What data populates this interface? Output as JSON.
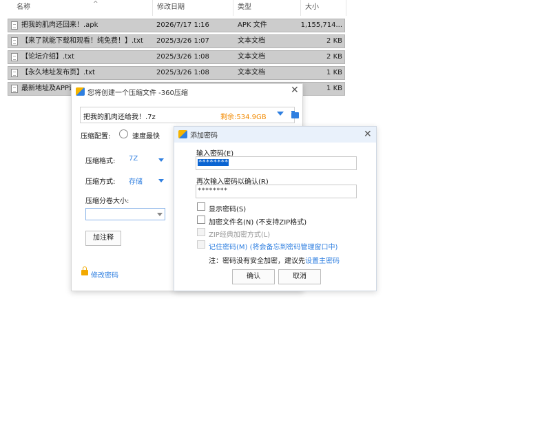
{
  "file_list": {
    "columns": {
      "name": "名称",
      "date": "修改日期",
      "type": "类型",
      "size": "大小"
    },
    "rows": [
      {
        "name": "把我的肌肉还回来！.apk",
        "date": "2026/7/17 1:16",
        "type": "APK 文件",
        "size": "1,155,714..."
      },
      {
        "name": "【来了就能下载和观看！纯免费！】.txt",
        "date": "2025/3/26 1:07",
        "type": "文本文档",
        "size": "2 KB"
      },
      {
        "name": "【论坛介绍】.txt",
        "date": "2025/3/26 1:08",
        "type": "文本文档",
        "size": "2 KB"
      },
      {
        "name": "【永久地址发布页】.txt",
        "date": "2025/3/26 1:08",
        "type": "文本文档",
        "size": "1 KB"
      },
      {
        "name": "最新地址及APP请",
        "date": "",
        "type": "",
        "size": "1 KB"
      }
    ]
  },
  "compress_dialog": {
    "title": "您将创建一个压缩文件 -360压缩",
    "archive_name": "把我的肌肉还给我！.7z",
    "free_space": "剩余:534.9GB",
    "config_label": "压缩配置:",
    "config_option": "速度最快",
    "format_label": "压缩格式:",
    "format_value": "7Z",
    "method_label": "压缩方式:",
    "method_value": "存储",
    "split_label": "压缩分卷大小:",
    "comment_button": "加注释",
    "change_password": "修改密码"
  },
  "password_dialog": {
    "title": "添加密码",
    "enter_label": "输入密码(E)",
    "enter_value": "********",
    "confirm_label": "再次输入密码以确认(R)",
    "confirm_value": "********",
    "show_password": "显示密码(S)",
    "encrypt_filenames": "加密文件名(N) (不支持ZIP格式)",
    "zip_classic": "ZIP经典加密方式(L)",
    "remember_password": "记住密码(M) (将会备忘到密码管理窗口中)",
    "note_prefix": "注：密码没有安全加密，建议先",
    "note_link": "设置主密码",
    "ok_button": "确认",
    "cancel_button": "取消"
  },
  "colors": {
    "accent": "#2f7fe0",
    "free_space": "#f28a00",
    "row_selected": "#cccccc"
  }
}
